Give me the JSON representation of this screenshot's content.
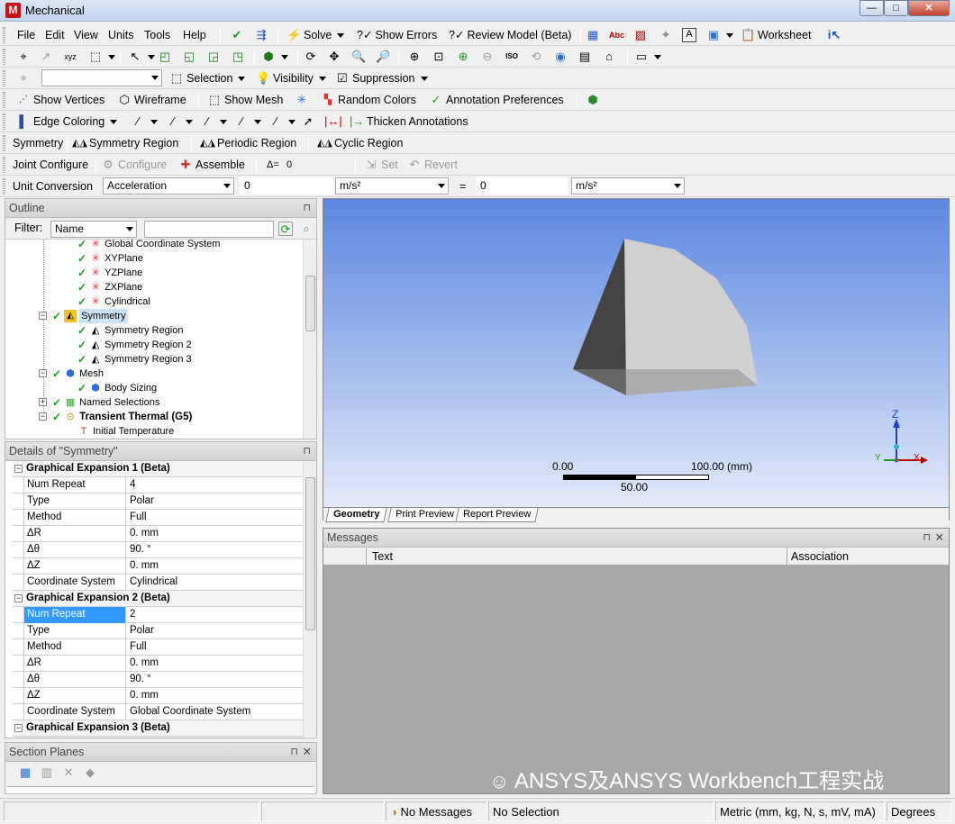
{
  "window": {
    "title": "Mechanical",
    "icon": "M",
    "min": "—",
    "max": "□",
    "close": "✕"
  },
  "menubar": {
    "items": [
      "File",
      "Edit",
      "View",
      "Units",
      "Tools",
      "Help"
    ],
    "solve": "Solve",
    "show_errors": "Show Errors",
    "review_model": "Review Model (Beta)",
    "worksheet": "Worksheet"
  },
  "toolbar3": {
    "selection": "Selection",
    "visibility": "Visibility",
    "suppression": "Suppression"
  },
  "toolbar4": {
    "show_vertices": "Show Vertices",
    "wireframe": "Wireframe",
    "show_mesh": "Show Mesh",
    "random_colors": "Random Colors",
    "annotation_prefs": "Annotation Preferences"
  },
  "toolbar5": {
    "edge_coloring": "Edge Coloring",
    "thicken": "Thicken Annotations"
  },
  "toolbar6": {
    "symmetry": "Symmetry",
    "symmetry_region": "Symmetry Region",
    "periodic_region": "Periodic Region",
    "cyclic_region": "Cyclic Region"
  },
  "toolbar7": {
    "joint_configure": "Joint Configure",
    "configure": "Configure",
    "assemble": "Assemble",
    "delta": "Δ=",
    "delta_val": "0",
    "set": "Set",
    "revert": "Revert"
  },
  "unitconv": {
    "label": "Unit Conversion",
    "quantity": "Acceleration",
    "value1": "0",
    "unit1": "m/s²",
    "equals": "=",
    "value2": "0",
    "unit2": "m/s²"
  },
  "outline": {
    "title": "Outline",
    "pin": "⊓",
    "filter_label": "Filter:",
    "filter_value": "Name",
    "nodes": [
      "Global Coordinate System",
      "XYPlane",
      "YZPlane",
      "ZXPlane",
      "Cylindrical",
      "Symmetry",
      "Symmetry Region",
      "Symmetry Region 2",
      "Symmetry Region 3",
      "Mesh",
      "Body Sizing",
      "Named Selections",
      "Transient Thermal (G5)",
      "Initial Temperature"
    ]
  },
  "details": {
    "title": "Details of \"Symmetry\"",
    "groups": [
      {
        "name": "Graphical Expansion 1 (Beta)",
        "rows": [
          [
            "Num Repeat",
            "4"
          ],
          [
            "Type",
            "Polar"
          ],
          [
            "Method",
            "Full"
          ],
          [
            "ΔR",
            "0. mm"
          ],
          [
            "Δθ",
            "90. °"
          ],
          [
            "ΔZ",
            "0. mm"
          ],
          [
            "Coordinate System",
            "Cylindrical"
          ]
        ]
      },
      {
        "name": "Graphical Expansion 2 (Beta)",
        "rows": [
          [
            "Num Repeat",
            "2"
          ],
          [
            "Type",
            "Polar"
          ],
          [
            "Method",
            "Full"
          ],
          [
            "ΔR",
            "0. mm"
          ],
          [
            "Δθ",
            "90. °"
          ],
          [
            "ΔZ",
            "0. mm"
          ],
          [
            "Coordinate System",
            "Global Coordinate System"
          ]
        ]
      },
      {
        "name": "Graphical Expansion 3 (Beta)",
        "rows": []
      }
    ]
  },
  "section_planes": {
    "title": "Section Planes"
  },
  "viewport": {
    "scale_start": "0.00",
    "scale_end": "100.00 (mm)",
    "scale_mid": "50.00",
    "axis_z": "Z",
    "axis_y": "Y",
    "axis_x": "X"
  },
  "tabs": [
    "Geometry",
    "Print Preview",
    "Report Preview"
  ],
  "messages": {
    "title": "Messages",
    "col_text": "Text",
    "col_assoc": "Association"
  },
  "watermark": "ANSYS及ANSYS Workbench工程实战",
  "status": {
    "messages": "No Messages",
    "selection": "No Selection",
    "units": "Metric (mm, kg, N, s, mV, mA)",
    "angle": "Degrees"
  }
}
